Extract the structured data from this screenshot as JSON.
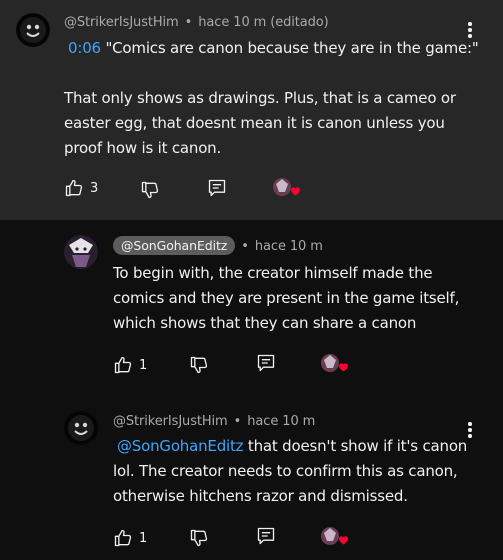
{
  "comments": [
    {
      "author": "@StrikerIsJustHim",
      "separator": "•",
      "time": "hace 10 m (editado)",
      "timestamp_link": "0:06",
      "line1_rest": " \"Comics are canon because they are in the game:\"",
      "paragraph2": "That only shows as drawings. Plus, that is a cameo or easter egg, that doesnt mean it is canon unless you proof how is it canon.",
      "likes": "3",
      "icons": {
        "like": "thumb-up-icon",
        "dislike": "thumb-down-icon",
        "reply": "reply-icon",
        "more": "more-vert-icon"
      }
    },
    {
      "author": "@SonGohanEditz",
      "separator": "•",
      "time": "hace 10 m",
      "text": "To begin with, the creator himself made the comics and they are present in the game itself, which shows that they can share a canon",
      "likes": "1"
    },
    {
      "author": "@StrikerIsJustHim",
      "separator": "•",
      "time": "hace 10 m",
      "mention": "@SonGohanEditz",
      "text": " that doesn't show if it's canon lol. The creator needs to confirm this as canon, otherwise hitchens razor and dismissed.",
      "likes": "1"
    }
  ],
  "colors": {
    "background": "#0f0f0f",
    "highlight_background": "#272727",
    "link": "#3ea6ff",
    "secondary_text": "#aaaaaa",
    "heart": "#ff0033"
  }
}
